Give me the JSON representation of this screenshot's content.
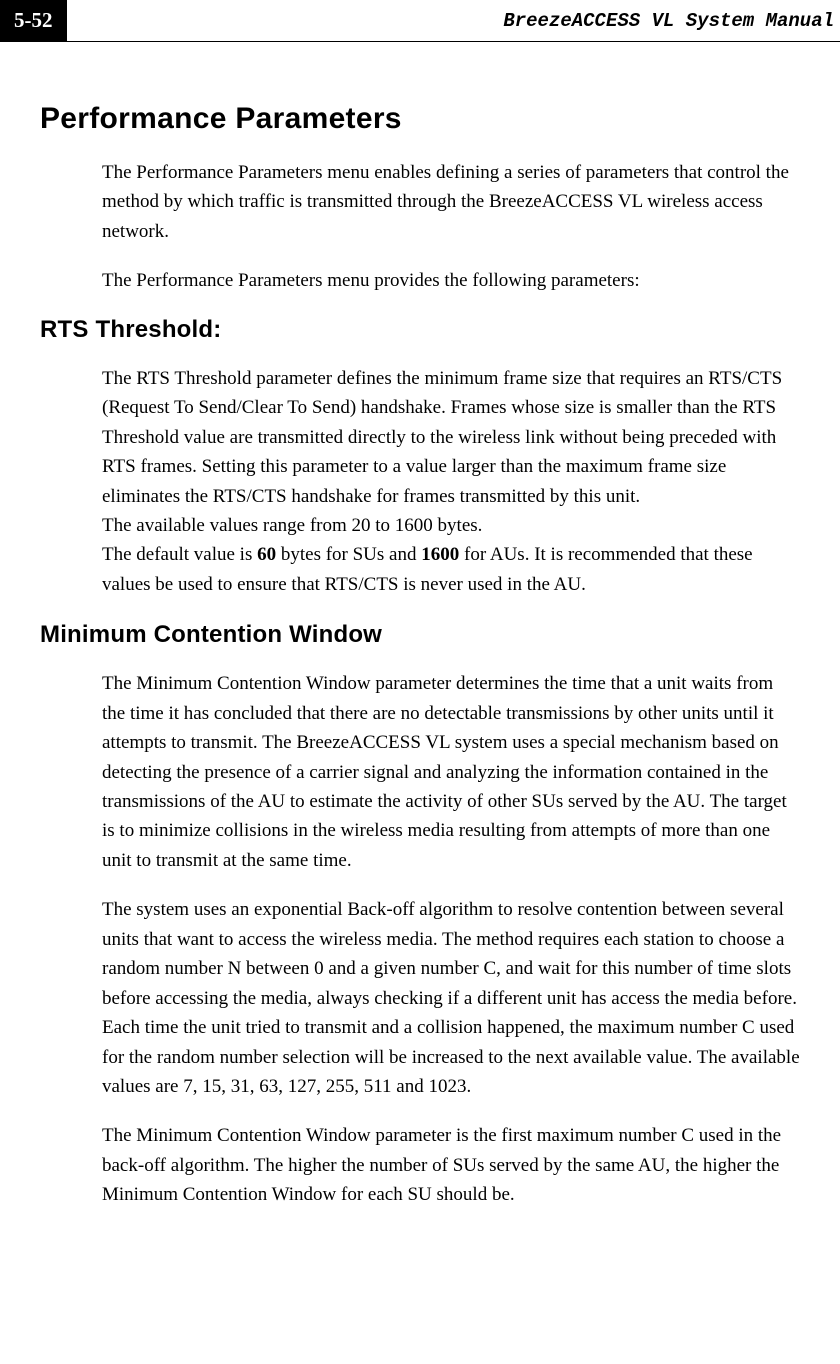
{
  "header": {
    "page_number": "5-52",
    "manual_title": "BreezeACCESS VL System Manual"
  },
  "sections": {
    "performance_parameters": {
      "heading": "Performance Parameters",
      "p1": "The Performance Parameters menu enables defining a series of parameters that control the method by which traffic is transmitted through the BreezeACCESS VL wireless access network.",
      "p2": "The Performance Parameters menu provides the following parameters:"
    },
    "rts_threshold": {
      "heading": "RTS Threshold:",
      "p1_part1": "The RTS Threshold parameter defines the minimum frame size that requires an RTS/CTS (Request To Send/Clear To Send) handshake. Frames whose size is smaller than the RTS Threshold value are transmitted directly to the wireless link without being preceded with RTS frames. Setting this parameter to a value larger than the maximum frame size eliminates the RTS/CTS handshake for frames transmitted by this unit.",
      "p1_part2": "The available values range from 20 to 1600 bytes.",
      "p1_part3a": "The default value is ",
      "p1_bold1": "60",
      "p1_part3b": " bytes for SUs and ",
      "p1_bold2": "1600",
      "p1_part3c": " for AUs. It is recommended that these values be used to ensure that RTS/CTS is never used in the AU."
    },
    "min_contention_window": {
      "heading": "Minimum Contention Window",
      "p1": "The Minimum Contention Window parameter determines the time that a unit waits from the time it has concluded that there are no detectable transmissions by other units until it attempts to transmit. The BreezeACCESS VL system uses a special mechanism based on detecting the presence of a carrier signal and analyzing the information contained in the transmissions of the AU to estimate the activity of other SUs served by the AU. The target is to minimize collisions in the wireless media resulting from attempts of more than one unit to transmit at the same time.",
      "p2": "The system uses an exponential Back-off algorithm to resolve contention between several units that want to access the wireless media. The method requires each station to choose a random number N between 0 and a given number C, and wait for this number of time slots before accessing the media, always checking if a different unit has access the media before. Each time the unit tried to transmit and a collision happened, the maximum number C used for the random number selection will be increased to the next available value. The available values are 7, 15, 31, 63, 127, 255, 511 and 1023.",
      "p3": "The Minimum Contention Window parameter is the first maximum number C used in the back-off algorithm. The higher the number of SUs served by the same AU, the higher the Minimum Contention Window for each SU should be."
    }
  }
}
